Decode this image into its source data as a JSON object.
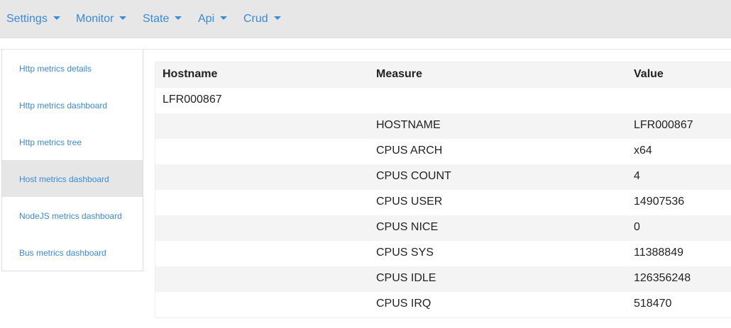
{
  "nav": {
    "items": [
      {
        "label": "Settings"
      },
      {
        "label": "Monitor"
      },
      {
        "label": "State"
      },
      {
        "label": "Api"
      },
      {
        "label": "Crud"
      }
    ]
  },
  "sidebar": {
    "items": [
      {
        "label": "Http metrics details"
      },
      {
        "label": "Http metrics dashboard"
      },
      {
        "label": "Http metrics tree"
      },
      {
        "label": "Host metrics dashboard"
      },
      {
        "label": "NodeJS metrics dashboard"
      },
      {
        "label": "Bus metrics dashboard"
      }
    ],
    "active": "Host metrics dashboard"
  },
  "table": {
    "headers": [
      "Hostname",
      "Measure",
      "Value"
    ],
    "host": "LFR000867",
    "rows": [
      {
        "measure": "HOSTNAME",
        "value": "LFR000867"
      },
      {
        "measure": "CPUS ARCH",
        "value": "x64"
      },
      {
        "measure": "CPUS COUNT",
        "value": "4"
      },
      {
        "measure": "CPUS USER",
        "value": "14907536"
      },
      {
        "measure": "CPUS NICE",
        "value": "0"
      },
      {
        "measure": "CPUS SYS",
        "value": "11388849"
      },
      {
        "measure": "CPUS IDLE",
        "value": "126356248"
      },
      {
        "measure": "CPUS IRQ",
        "value": "518470"
      }
    ]
  },
  "colors": {
    "link": "#3a8ad8",
    "navbar_bg": "#e7e7e7",
    "active_bg": "#e6e6e6",
    "stripe_bg": "#f4f4f4"
  }
}
